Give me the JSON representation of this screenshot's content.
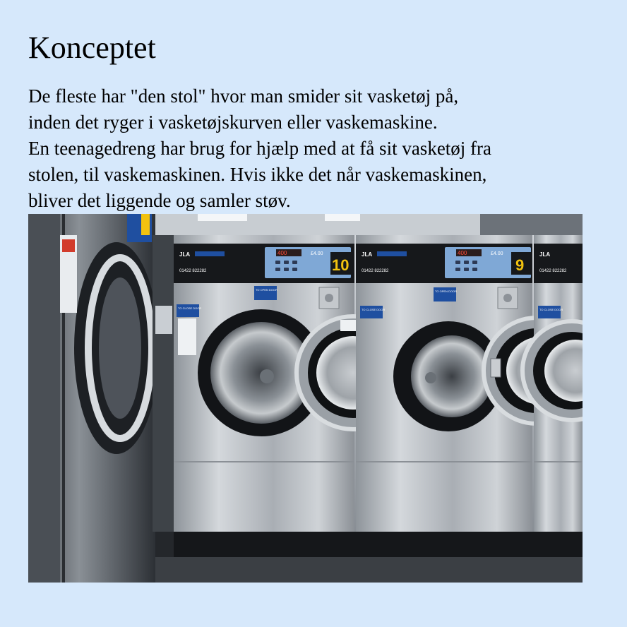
{
  "heading": "Konceptet",
  "intro_lines": [
    "De fleste har \"den stol\" hvor man smider sit vasketøj på,",
    "inden det ryger i vasketøjskurven eller vaskemaskine.",
    "En teenagedreng har brug for hjælp med at få sit vasketøj fra",
    "stolen, til vaskemaskinen. Hvis ikke det når vaskemaskinen,",
    "bliver det liggende og samler støv."
  ],
  "photo": {
    "machines": [
      {
        "brand": "JLA",
        "phone": "01422 822282",
        "display": "400",
        "price": "£4.00",
        "number": "10",
        "open_door_label": "TO OPEN DOOR",
        "close_door_label": "TO CLOSE DOOR"
      },
      {
        "brand": "JLA",
        "phone": "01422 822282",
        "display": "400",
        "price": "£4.00",
        "number": "9",
        "open_door_label": "TO OPEN DOOR",
        "close_door_label": "TO CLOSE DOOR"
      },
      {
        "brand": "JLA",
        "phone": "01422 822282",
        "close_door_label": "TO CLOSE DOOR"
      }
    ]
  },
  "colors": {
    "page_background": "#d6e8fb",
    "steel": "#b9bdc2",
    "panel_blue": "#7fa8d6",
    "number_yellow": "#f2c20f",
    "label_blue": "#1f4fa0"
  }
}
